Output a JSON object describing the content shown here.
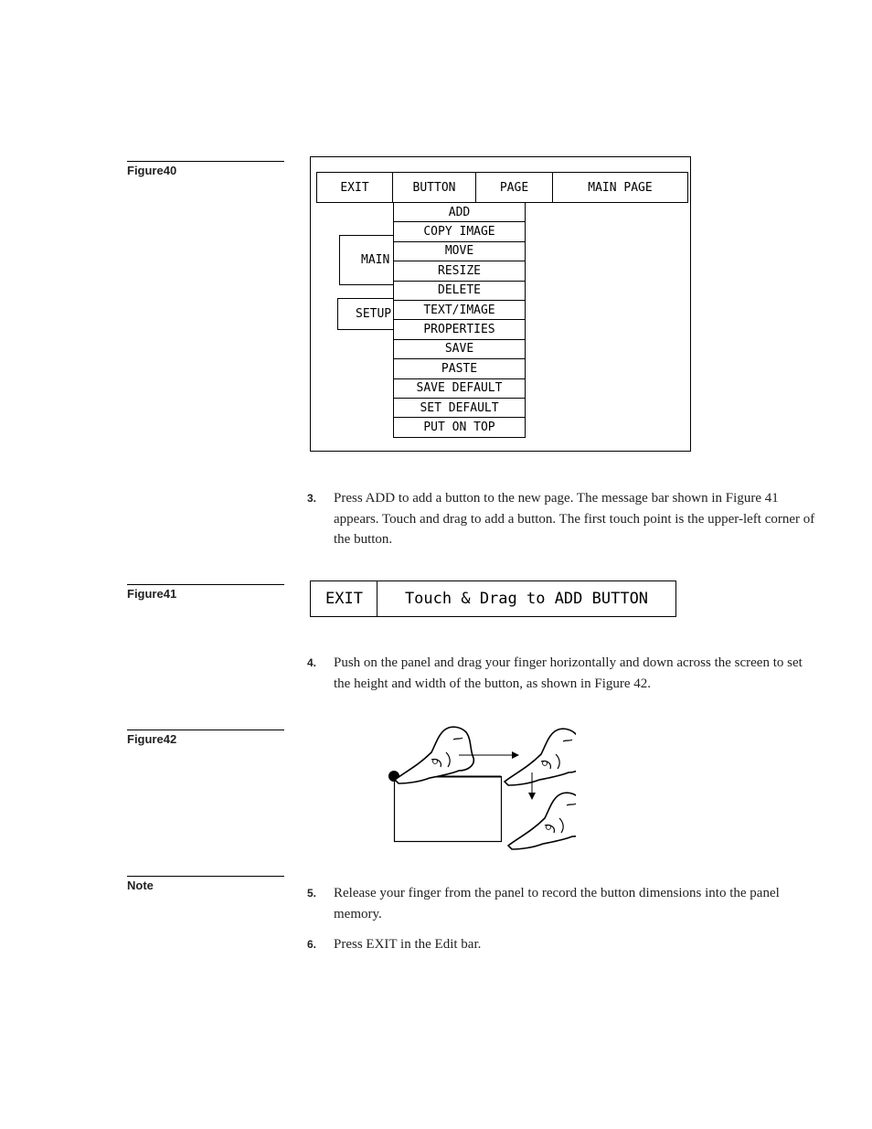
{
  "figure40": {
    "label": "Figure40",
    "topbar": [
      "EXIT",
      "BUTTON",
      "PAGE",
      "MAIN PAGE"
    ],
    "menu": [
      "ADD",
      "COPY IMAGE",
      "MOVE",
      "RESIZE",
      "DELETE",
      "TEXT/IMAGE",
      "PROPERTIES",
      "SAVE",
      "PASTE",
      "SAVE DEFAULT",
      "SET DEFAULT",
      "PUT ON TOP"
    ],
    "bg_buttons": [
      "MAIN",
      "SETUP"
    ]
  },
  "step3": {
    "num": "3.",
    "text": "Press ADD to add a button to the new page. The message bar shown in Figure 41 appears. Touch and drag to add a button. The first touch point is the upper-left corner of the button."
  },
  "figure41": {
    "label": "Figure41",
    "exit": "EXIT",
    "message": "Touch & Drag to ADD BUTTON"
  },
  "step4": {
    "num": "4.",
    "text": "Push on the panel and drag your finger horizontally and down across the screen to set the height and width of the button, as shown in Figure 42."
  },
  "figure42": {
    "label": "Figure42",
    "icons": [
      "pointing-hand-icon",
      "arrow-right-icon",
      "arrow-down-icon"
    ]
  },
  "note": {
    "label": "Note"
  },
  "step5": {
    "num": "5.",
    "text": "Release your finger from the panel to record the button dimensions into the panel memory."
  },
  "step6": {
    "num": "6.",
    "text": "Press EXIT in the Edit bar."
  }
}
